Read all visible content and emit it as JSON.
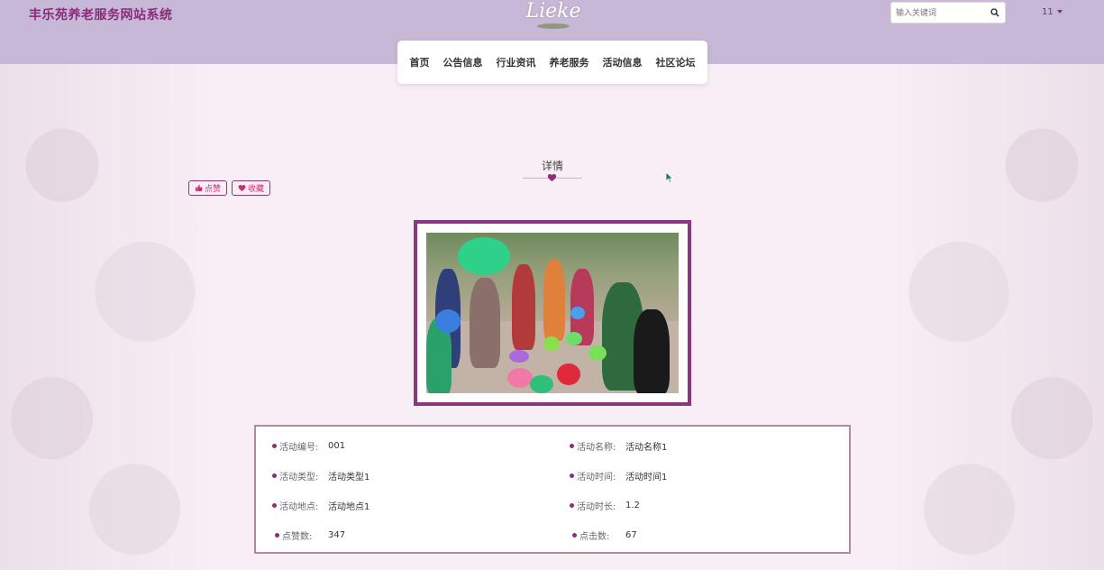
{
  "header": {
    "site_title": "丰乐苑养老服务网站系统",
    "logo_text": "Lieke",
    "search_placeholder": "输入关键词",
    "user_label": "11"
  },
  "nav": {
    "items": [
      {
        "label": "首页"
      },
      {
        "label": "公告信息"
      },
      {
        "label": "行业资讯"
      },
      {
        "label": "养老服务"
      },
      {
        "label": "活动信息"
      },
      {
        "label": "社区论坛"
      }
    ]
  },
  "detail": {
    "title": "详情",
    "like_label": "点赞",
    "favorite_label": "收藏"
  },
  "info": {
    "fields": [
      {
        "label": "活动编号:",
        "value": "001"
      },
      {
        "label": "活动名称:",
        "value": "活动名称1"
      },
      {
        "label": "活动类型:",
        "value": "活动类型1"
      },
      {
        "label": "活动时间:",
        "value": "活动时间1"
      },
      {
        "label": "活动地点:",
        "value": "活动地点1"
      },
      {
        "label": "活动时长:",
        "value": "1.2"
      },
      {
        "label": "点赞数:",
        "value": "347"
      },
      {
        "label": "点击数:",
        "value": "67"
      }
    ]
  },
  "colors": {
    "header_bg": "#c6b8d6",
    "accent": "#8c2a7a",
    "page_bg": "#f8eef6"
  },
  "icons": {
    "search": "search-icon",
    "like": "thumbs-up-icon",
    "favorite": "heart-icon",
    "user_caret": "caret-down-icon"
  }
}
